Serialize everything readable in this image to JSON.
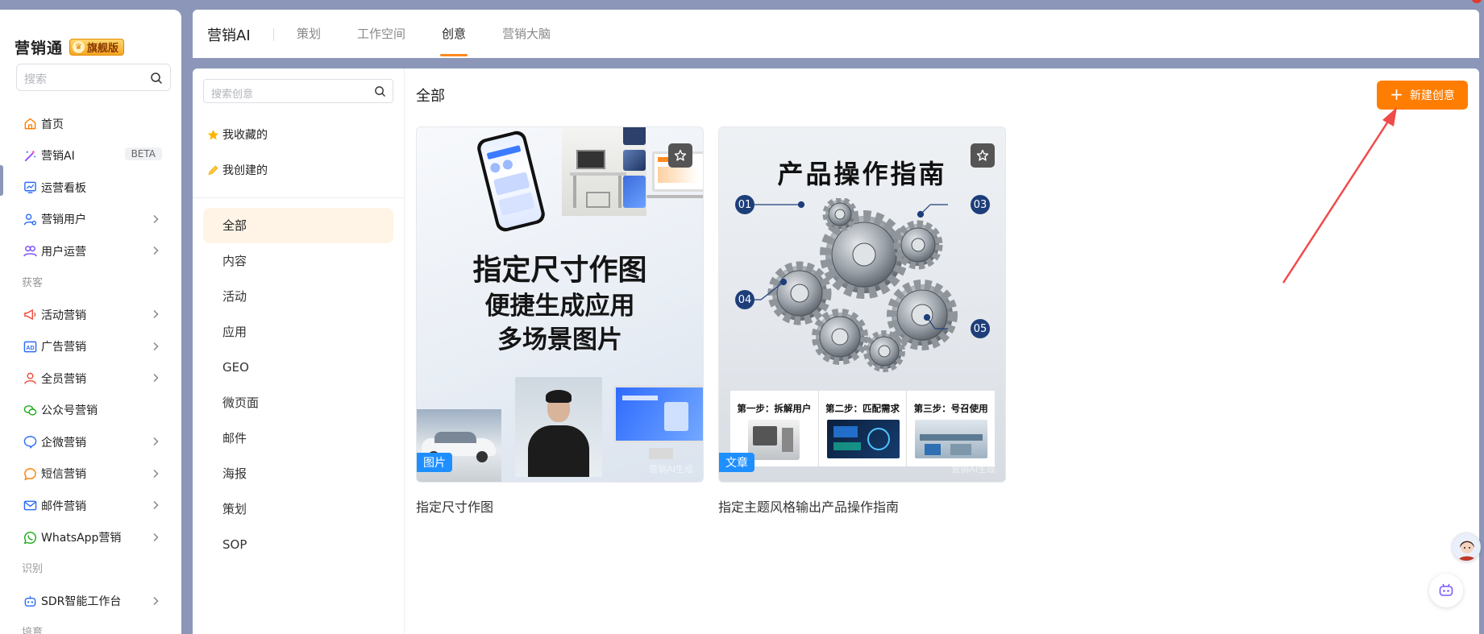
{
  "sidebar": {
    "brand_name": "营销通",
    "brand_badge": "旗舰版",
    "search_placeholder": "搜索",
    "items": [
      {
        "label": "首页"
      },
      {
        "label": "营销AI",
        "badge": "BETA"
      },
      {
        "label": "运营看板"
      },
      {
        "label": "营销用户"
      },
      {
        "label": "用户运营"
      },
      {
        "section": "获客"
      },
      {
        "label": "活动营销"
      },
      {
        "label": "广告营销"
      },
      {
        "label": "全员营销"
      },
      {
        "label": "公众号营销"
      },
      {
        "label": "企微营销"
      },
      {
        "label": "短信营销"
      },
      {
        "label": "邮件营销"
      },
      {
        "label": "WhatsApp营销"
      },
      {
        "section": "识别"
      },
      {
        "label": "SDR智能工作台"
      },
      {
        "section": "培育"
      }
    ]
  },
  "header": {
    "app_title": "营销AI",
    "tabs": [
      {
        "label": "策划"
      },
      {
        "label": "工作空间"
      },
      {
        "label": "创意",
        "active": true
      },
      {
        "label": "营销大脑"
      }
    ]
  },
  "categories": {
    "search_placeholder": "搜索创意",
    "quick": [
      {
        "label": "我收藏的",
        "icon": "star-icon"
      },
      {
        "label": "我创建的",
        "icon": "pencil-icon"
      }
    ],
    "items": [
      {
        "label": "全部",
        "active": true
      },
      {
        "label": "内容"
      },
      {
        "label": "活动"
      },
      {
        "label": "应用"
      },
      {
        "label": "GEO"
      },
      {
        "label": "微页面"
      },
      {
        "label": "邮件"
      },
      {
        "label": "海报"
      },
      {
        "label": "策划"
      },
      {
        "label": "SOP"
      }
    ]
  },
  "main": {
    "heading": "全部",
    "new_button": "新建创意",
    "cards": [
      {
        "title": "指定尺寸作图",
        "type_tag": "图片",
        "art_lines": [
          "指定尺寸作图",
          "便捷生成应用",
          "多场景图片"
        ],
        "watermark": "营销AI生成"
      },
      {
        "title": "指定主题风格输出产品操作指南",
        "type_tag": "文章",
        "art_heading": "产品操作指南",
        "art_numbers": [
          "01",
          "03",
          "04",
          "05"
        ],
        "art_steps": [
          "第一步：拆解用户",
          "第二步：匹配需求",
          "第三步：号召使用"
        ],
        "watermark": "营销AI生成"
      }
    ]
  },
  "colors": {
    "accent": "#ff7d00",
    "tag_blue": "#1f8fff",
    "page_bg": "#8b96b8"
  }
}
